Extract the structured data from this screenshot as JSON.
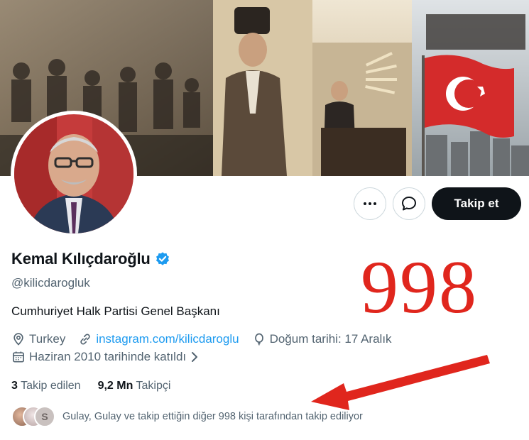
{
  "profile": {
    "name": "Kemal Kılıçdaroğlu",
    "handle": "@kilicdarogluk",
    "bio": "Cumhuriyet Halk Partisi Genel Başkanı",
    "location": "Turkey",
    "website": "instagram.com/kilicdaroglu",
    "birthday": "Doğum tarihi: 17 Aralık",
    "joined": "Haziran 2010 tarihinde katıldı",
    "following_count": "3",
    "following_label": "Takip edilen",
    "followers_count": "9,2 Mn",
    "followers_label": "Takipçi",
    "followed_by_text": "Gulay, Gulay ve takip ettiğin diğer 998 kişi tarafından takip ediliyor",
    "verified": true
  },
  "actions": {
    "follow_label": "Takip et",
    "more_icon": "more-icon",
    "message_icon": "message-icon"
  },
  "annotation": {
    "number": "998",
    "color": "#e0261d"
  },
  "colors": {
    "link": "#1d9bf0",
    "verified": "#1d9bf0",
    "text": "#0f1419",
    "secondary": "#536471",
    "follow_button": "#0f1419"
  }
}
